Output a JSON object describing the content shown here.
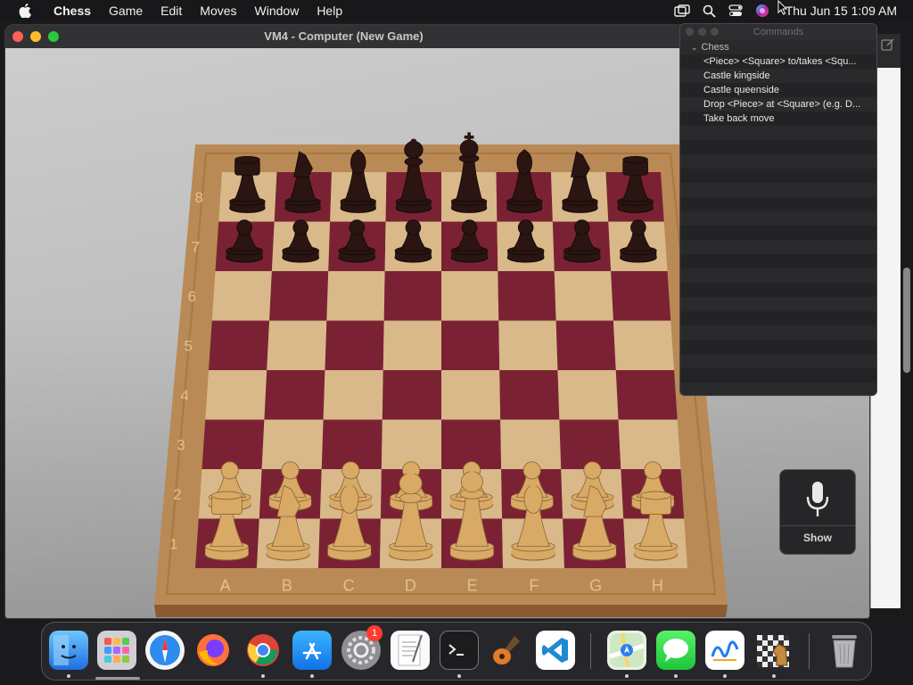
{
  "menubar": {
    "app_name": "Chess",
    "items": [
      "Game",
      "Edit",
      "Moves",
      "Window",
      "Help"
    ],
    "clock": "Thu Jun 15  1:09 AM"
  },
  "window": {
    "title": "VM4 - Computer   (New Game)"
  },
  "board": {
    "rank_labels": [
      "8",
      "7",
      "6",
      "5",
      "4",
      "3",
      "2",
      "1"
    ],
    "file_labels": [
      "A",
      "B",
      "C",
      "D",
      "E",
      "F",
      "G",
      "H"
    ],
    "colors": {
      "light_square": "#d9b98a",
      "dark_square": "#7a2234",
      "frame": "#b98a55",
      "black_piece": "#2a1512",
      "white_piece": "#d8aa66"
    },
    "pieces": {
      "8": [
        "rook",
        "knight",
        "bishop",
        "queen",
        "king",
        "bishop",
        "knight",
        "rook"
      ],
      "7": [
        "pawn",
        "pawn",
        "pawn",
        "pawn",
        "pawn",
        "pawn",
        "pawn",
        "pawn"
      ],
      "2": [
        "pawn",
        "pawn",
        "pawn",
        "pawn",
        "pawn",
        "pawn",
        "pawn",
        "pawn"
      ],
      "1": [
        "rook",
        "knight",
        "bishop",
        "queen",
        "king",
        "bishop",
        "knight",
        "rook"
      ]
    }
  },
  "commands": {
    "title": "Commands",
    "group": "Chess",
    "items": [
      "<Piece> <Square> to/takes <Squ...",
      "Castle kingside",
      "Castle queenside",
      "Drop <Piece> at <Square> (e.g. D...",
      "Take back move"
    ]
  },
  "voice": {
    "show_label": "Show"
  },
  "dock": {
    "apps": [
      "finder-icon",
      "launchpad-icon",
      "safari-icon",
      "firefox-icon",
      "chrome-icon",
      "app-store-icon",
      "system-settings-icon",
      "textedit-icon",
      "terminal-icon",
      "garageband-icon",
      "vscode-icon",
      "maps-icon",
      "messages-icon",
      "freeform-icon",
      "chess-icon",
      "trash-icon"
    ],
    "settings_badge": "1"
  }
}
